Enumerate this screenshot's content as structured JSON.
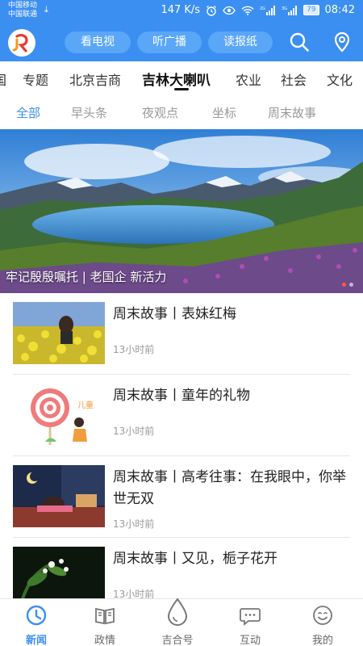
{
  "status_bar": {
    "carrier_1": "中国移动",
    "carrier_2": "中国联通",
    "net_speed": "147 K/s",
    "battery": "79",
    "time": "08:42"
  },
  "header": {
    "buttons": [
      "看电视",
      "听广播",
      "读报纸"
    ],
    "brand_color": "#3b8ff0"
  },
  "channel_tabs": [
    "国",
    "专题",
    "北京吉商",
    "吉林大喇叭",
    "农业",
    "社会",
    "文化"
  ],
  "channel_active_index": 3,
  "sub_tabs": [
    "全部",
    "早头条",
    "夜观点",
    "坐标",
    "周末故事"
  ],
  "sub_active_index": 0,
  "banner": {
    "caption": "牢记殷殷嘱托 | 老国企 新活力",
    "slide_count": 2,
    "active_slide": 0
  },
  "articles": [
    {
      "title": "周末故事丨表妹红梅",
      "time": "13小时前",
      "thumb_icon": "rapeseed-field-photo"
    },
    {
      "title": "周末故事丨童年的礼物",
      "time": "13小时前",
      "thumb_icon": "lollipop-illustration"
    },
    {
      "title": "周末故事丨高考往事：在我眼中，你举世无双",
      "time": "13小时前",
      "thumb_icon": "study-desk-illustration"
    },
    {
      "title": "周末故事丨又见，栀子花开",
      "time": "13小时前",
      "thumb_icon": "gardenia-flower-photo"
    }
  ],
  "bottom_nav": [
    {
      "label": "新闻",
      "icon": "clock-icon"
    },
    {
      "label": "政情",
      "icon": "book-icon"
    },
    {
      "label": "吉合号",
      "icon": "drop-icon"
    },
    {
      "label": "互动",
      "icon": "chat-bubble-icon"
    },
    {
      "label": "我的",
      "icon": "smiley-icon"
    }
  ],
  "bottom_nav_active_index": 0
}
